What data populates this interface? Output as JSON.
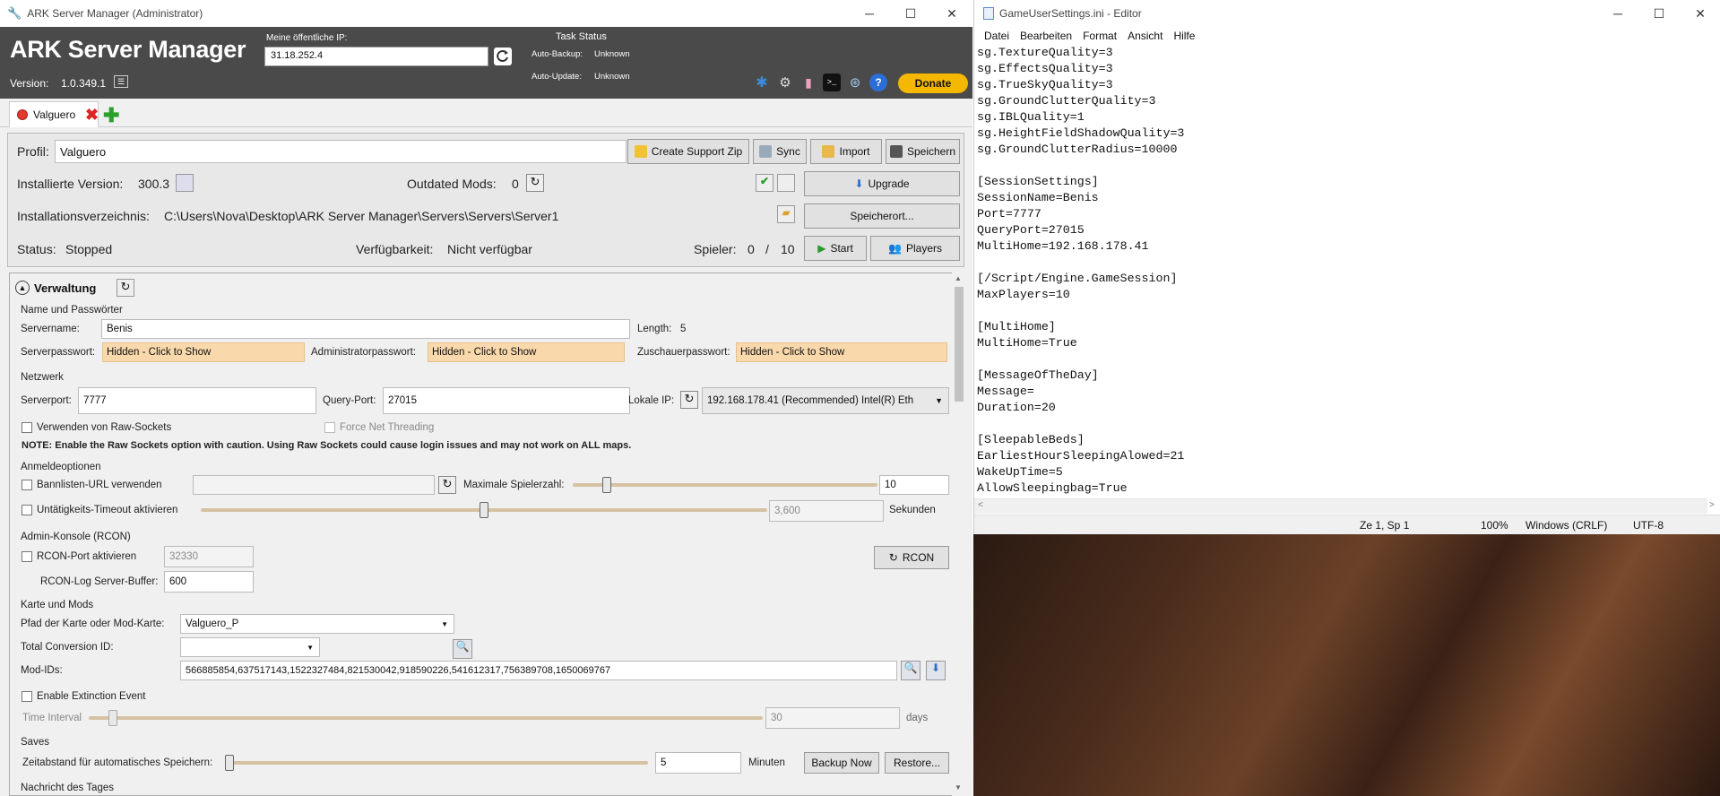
{
  "asm": {
    "window_title": "ARK Server Manager (Administrator)",
    "app_title": "ARK Server Manager",
    "public_ip_label": "Meine öffentliche IP:",
    "public_ip": "31.18.252.4",
    "version_label": "Version:",
    "version": "1.0.349.1",
    "task_status": {
      "title": "Task Status",
      "auto_backup_label": "Auto-Backup:",
      "auto_backup": "Unknown",
      "auto_update_label": "Auto-Update:",
      "auto_update": "Unknown"
    },
    "donate_label": "Donate",
    "tab_label": "Valguero",
    "profile": {
      "label": "Profil:",
      "value": "Valguero",
      "create_support_zip": "Create Support Zip",
      "sync": "Sync",
      "import": "Import",
      "save": "Speichern",
      "installed_version_label": "Installierte Version:",
      "installed_version": "300.3",
      "outdated_mods_label": "Outdated Mods:",
      "outdated_mods": "0",
      "upgrade": "Upgrade",
      "install_dir_label": "Installationsverzeichnis:",
      "install_dir": "C:\\Users\\Nova\\Desktop\\ARK Server Manager\\Servers\\Servers\\Server1",
      "location_button": "Speicherort...",
      "status_label": "Status:",
      "status": "Stopped",
      "availability_label": "Verfügbarkeit:",
      "availability": "Nicht verfügbar",
      "players_label": "Spieler:",
      "players_current": "0",
      "players_sep": "/",
      "players_max": "10",
      "start": "Start",
      "players_button": "Players"
    },
    "admin": {
      "section_title": "Verwaltung",
      "names_title": "Name und Passwörter",
      "servername_label": "Servername:",
      "servername": "Benis",
      "length_label": "Length:",
      "length": "5",
      "server_pw_label": "Serverpasswort:",
      "server_pw": "Hidden - Click to Show",
      "admin_pw_label": "Administratorpasswort:",
      "admin_pw": "Hidden - Click to Show",
      "spectator_pw_label": "Zuschauerpasswort:",
      "spectator_pw": "Hidden - Click to Show",
      "network_title": "Netzwerk",
      "serverport_label": "Serverport:",
      "serverport": "7777",
      "queryport_label": "Query-Port:",
      "queryport": "27015",
      "local_ip_label": "Lokale IP:",
      "local_ip": "192.168.178.41   (Recommended) Intel(R) Eth",
      "raw_sockets_label": "Verwenden von Raw-Sockets",
      "force_net_label": "Force Net Threading",
      "note": "NOTE: Enable the Raw Sockets option with caution. Using Raw Sockets could cause login issues and may not work on ALL maps.",
      "login_title": "Anmeldeoptionen",
      "banlist_label": "Bannlisten-URL verwenden",
      "max_players_label": "Maximale Spielerzahl:",
      "max_players": "10",
      "max_players_fraction": 0.1,
      "idle_timeout_label": "Untätigkeits-Timeout aktivieren",
      "idle_timeout": "3,600",
      "idle_timeout_fraction": 0.5,
      "seconds_label": "Sekunden",
      "rcon_title": "Admin-Konsole (RCON)",
      "rcon_port_label": "RCON-Port aktivieren",
      "rcon_port": "32330",
      "rcon_button": "RCON",
      "rcon_log_label": "RCON-Log Server-Buffer:",
      "rcon_log": "600",
      "maps_title": "Karte und Mods",
      "map_path_label": "Pfad der Karte oder Mod-Karte:",
      "map_path": "Valguero_P",
      "tc_label": "Total Conversion ID:",
      "mod_ids_label": "Mod-IDs:",
      "mod_ids": "566885854,637517143,1522327484,821530042,918590226,541612317,756389708,1650069767",
      "extinction_label": "Enable Extinction Event",
      "time_interval_label": "Time Interval",
      "time_interval": "30",
      "time_interval_fraction": 0.03,
      "days_label": "days",
      "saves_title": "Saves",
      "autosave_label": "Zeitabstand für automatisches Speichern:",
      "autosave": "5",
      "autosave_fraction": 0.0,
      "minutes_label": "Minuten",
      "backup_now": "Backup Now",
      "restore": "Restore...",
      "motd_title": "Nachricht des Tages"
    }
  },
  "notepad": {
    "window_title": "GameUserSettings.ini - Editor",
    "menu": [
      "Datei",
      "Bearbeiten",
      "Format",
      "Ansicht",
      "Hilfe"
    ],
    "lines": [
      "sg.TextureQuality=3",
      "sg.EffectsQuality=3",
      "sg.TrueSkyQuality=3",
      "sg.GroundClutterQuality=3",
      "sg.IBLQuality=1",
      "sg.HeightFieldShadowQuality=3",
      "sg.GroundClutterRadius=10000",
      "",
      "[SessionSettings]",
      "SessionName=Benis",
      "Port=7777",
      "QueryPort=27015",
      "MultiHome=192.168.178.41",
      "",
      "[/Script/Engine.GameSession]",
      "MaxPlayers=10",
      "",
      "[MultiHome]",
      "MultiHome=True",
      "",
      "[MessageOfTheDay]",
      "Message=",
      "Duration=20",
      "",
      "[SleepableBeds]",
      "EarliestHourSleepingAlowed=21",
      "WakeUpTime=5",
      "AllowSleepingbag=True"
    ],
    "status": {
      "position": "Ze 1, Sp 1",
      "zoom": "100%",
      "line_ending": "Windows (CRLF)",
      "encoding": "UTF-8"
    }
  }
}
